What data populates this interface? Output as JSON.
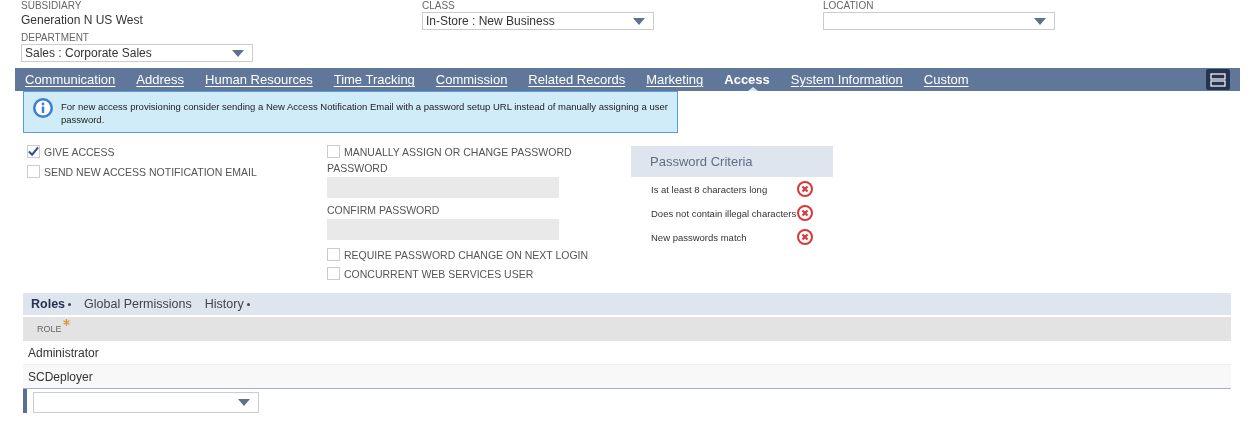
{
  "top_fields": [
    {
      "label": "SUBSIDIARY",
      "kind": "text",
      "value": "Generation N US West"
    },
    {
      "label": "CLASS",
      "kind": "select",
      "value": "In-Store : New Business"
    },
    {
      "label": "LOCATION",
      "kind": "select"
    },
    {
      "label": "DEPARTMENT",
      "kind": "select",
      "value": "Sales : Corporate Sales"
    }
  ],
  "tabs": [
    {
      "label": "Communication",
      "selected": false
    },
    {
      "label": "Address",
      "selected": false
    },
    {
      "label": "Human Resources",
      "selected": false
    },
    {
      "label": "Time Tracking",
      "selected": false
    },
    {
      "label": "Commission",
      "selected": false
    },
    {
      "label": "Related Records",
      "selected": false
    },
    {
      "label": "Marketing",
      "selected": false
    },
    {
      "label": "Access",
      "selected": true
    },
    {
      "label": "System Information",
      "selected": false
    },
    {
      "label": "Custom",
      "selected": false
    }
  ],
  "notice": {
    "text": "For new access provisioning consider sending a New Access Notification Email with a password setup URL instead of manually assigning a user password."
  },
  "access_options": [
    {
      "label": "GIVE ACCESS",
      "checked": true
    },
    {
      "label": "SEND NEW ACCESS NOTIFICATION EMAIL",
      "checked": false
    }
  ],
  "password_options": [
    {
      "kind": "checkbox",
      "label": "MANUALLY ASSIGN OR CHANGE PASSWORD",
      "checked": false
    },
    {
      "kind": "field",
      "label": "PASSWORD"
    },
    {
      "kind": "field",
      "label": "CONFIRM PASSWORD"
    },
    {
      "kind": "checkbox",
      "label": "REQUIRE PASSWORD CHANGE ON NEXT LOGIN",
      "checked": false
    },
    {
      "kind": "checkbox",
      "label": "CONCURRENT WEB SERVICES USER",
      "checked": false
    }
  ],
  "password_criteria": {
    "title": "Password Criteria",
    "items": [
      {
        "text": "Is at least 8 characters long",
        "met": false
      },
      {
        "text": "Does not contain illegal characters",
        "met": false
      },
      {
        "text": "New passwords match",
        "met": false
      }
    ]
  },
  "subtabs": [
    {
      "label": "Roles",
      "selected": true,
      "has_content": true
    },
    {
      "label": "Global Permissions",
      "selected": false,
      "has_content": false
    },
    {
      "label": "History",
      "selected": false,
      "has_content": true
    }
  ],
  "roles_table": {
    "columns": [
      {
        "label": "ROLE",
        "required": true
      }
    ],
    "rows": [
      {
        "role": "Administrator"
      },
      {
        "role": "SCDeployer"
      }
    ]
  }
}
